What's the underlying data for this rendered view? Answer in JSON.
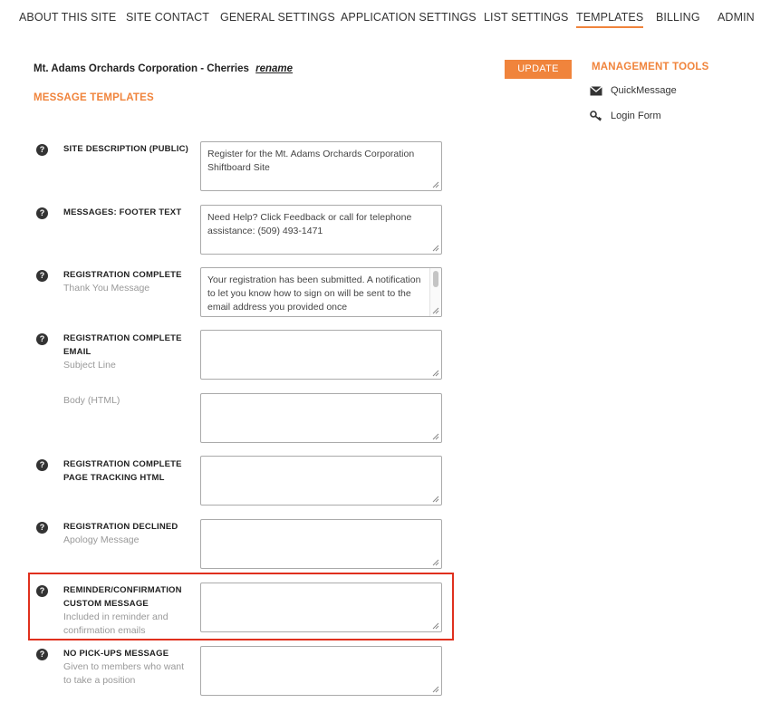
{
  "nav": {
    "items": [
      {
        "label": "ABOUT THIS SITE"
      },
      {
        "label": "SITE CONTACT"
      },
      {
        "label": "GENERAL SETTINGS"
      },
      {
        "label": "APPLICATION SETTINGS"
      },
      {
        "label": "LIST SETTINGS"
      },
      {
        "label": "TEMPLATES",
        "active": true
      },
      {
        "label": "BILLING"
      },
      {
        "label": "ADMIN"
      }
    ]
  },
  "site": {
    "name": "Mt. Adams Orchards Corporation - Cherries",
    "rename_label": "rename"
  },
  "section_heading": "MESSAGE TEMPLATES",
  "update_label": "UPDATE",
  "tools": {
    "heading": "MANAGEMENT TOOLS",
    "items": [
      {
        "label": "QuickMessage",
        "icon": "envelope-icon"
      },
      {
        "label": "Login Form",
        "icon": "key-icon"
      }
    ]
  },
  "fields": [
    {
      "title": "SITE DESCRIPTION (PUBLIC)",
      "subtitle": "",
      "value": "Register for the Mt. Adams Orchards Corporation Shiftboard Site"
    },
    {
      "title": "MESSAGES: FOOTER TEXT",
      "subtitle": "",
      "value": "Need Help? Click Feedback or call for telephone assistance: (509) 493-1471"
    },
    {
      "title": "REGISTRATION COMPLETE",
      "subtitle": "Thank You Message",
      "value": "Your registration has been submitted. A notification to let you know how to sign on will be sent to the email address you provided once"
    },
    {
      "title": "REGISTRATION COMPLETE EMAIL",
      "subtitle": "Subject Line",
      "value": ""
    },
    {
      "title": "",
      "subtitle": "Body (HTML)",
      "value": ""
    },
    {
      "title": "REGISTRATION COMPLETE PAGE TRACKING HTML",
      "subtitle": "",
      "value": ""
    },
    {
      "title": "REGISTRATION DECLINED",
      "subtitle": "Apology Message",
      "value": ""
    },
    {
      "title": "REMINDER/CONFIRMATION CUSTOM MESSAGE",
      "subtitle": "Included in reminder and confirmation emails",
      "value": ""
    },
    {
      "title": "NO PICK-UPS MESSAGE",
      "subtitle": "Given to members who want to take a position",
      "value": ""
    }
  ],
  "help_glyph": "?",
  "colors": {
    "accent": "#f0843c",
    "highlight": "#e0301e"
  }
}
